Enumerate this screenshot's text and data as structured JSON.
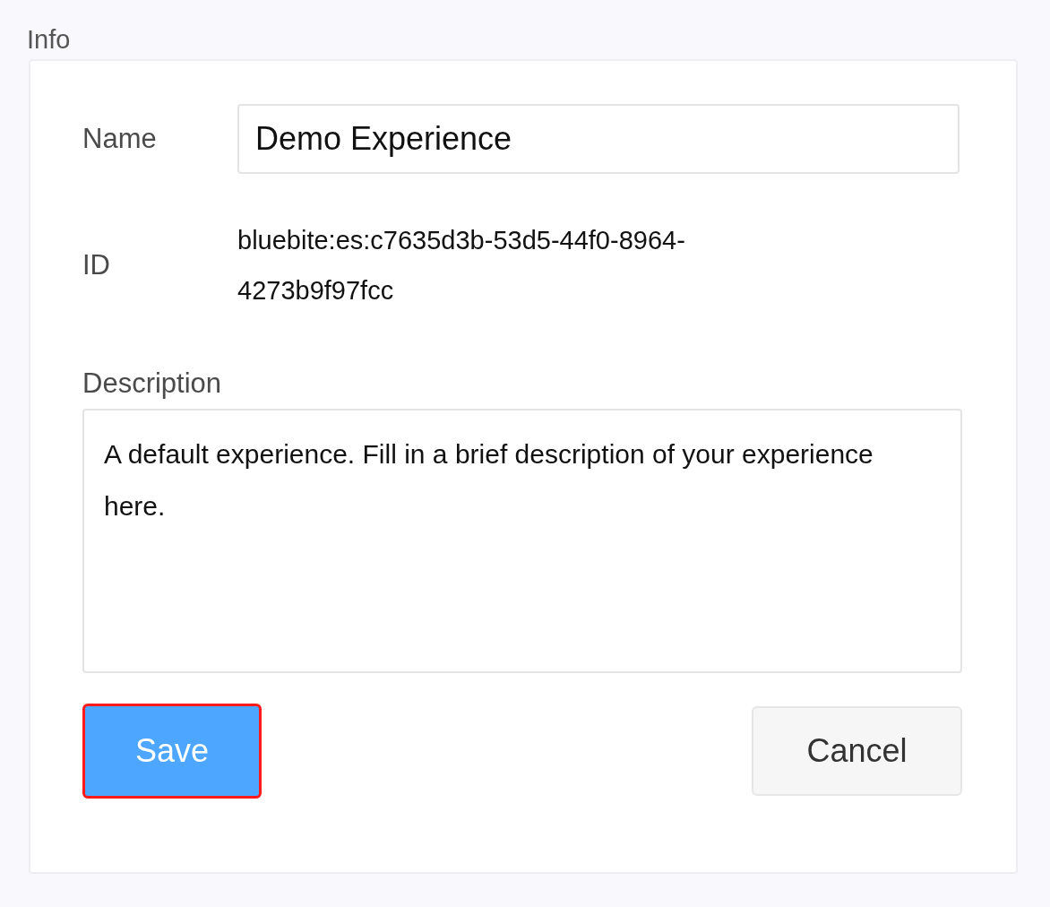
{
  "section_title": "Info",
  "fields": [
    {
      "kind": "input",
      "label": "Name",
      "value": "Demo Experience"
    },
    {
      "kind": "readonly",
      "label": "ID",
      "value": "bluebite:es:c7635d3b-53d5-44f0-8964-4273b9f97fcc"
    },
    {
      "kind": "textarea",
      "label": "Description",
      "value": "A default experience. Fill in a brief description of your experience here."
    }
  ],
  "buttons": [
    {
      "kind": "primary",
      "label": "Save",
      "focused": true
    },
    {
      "kind": "secondary",
      "label": "Cancel",
      "focused": false
    }
  ]
}
